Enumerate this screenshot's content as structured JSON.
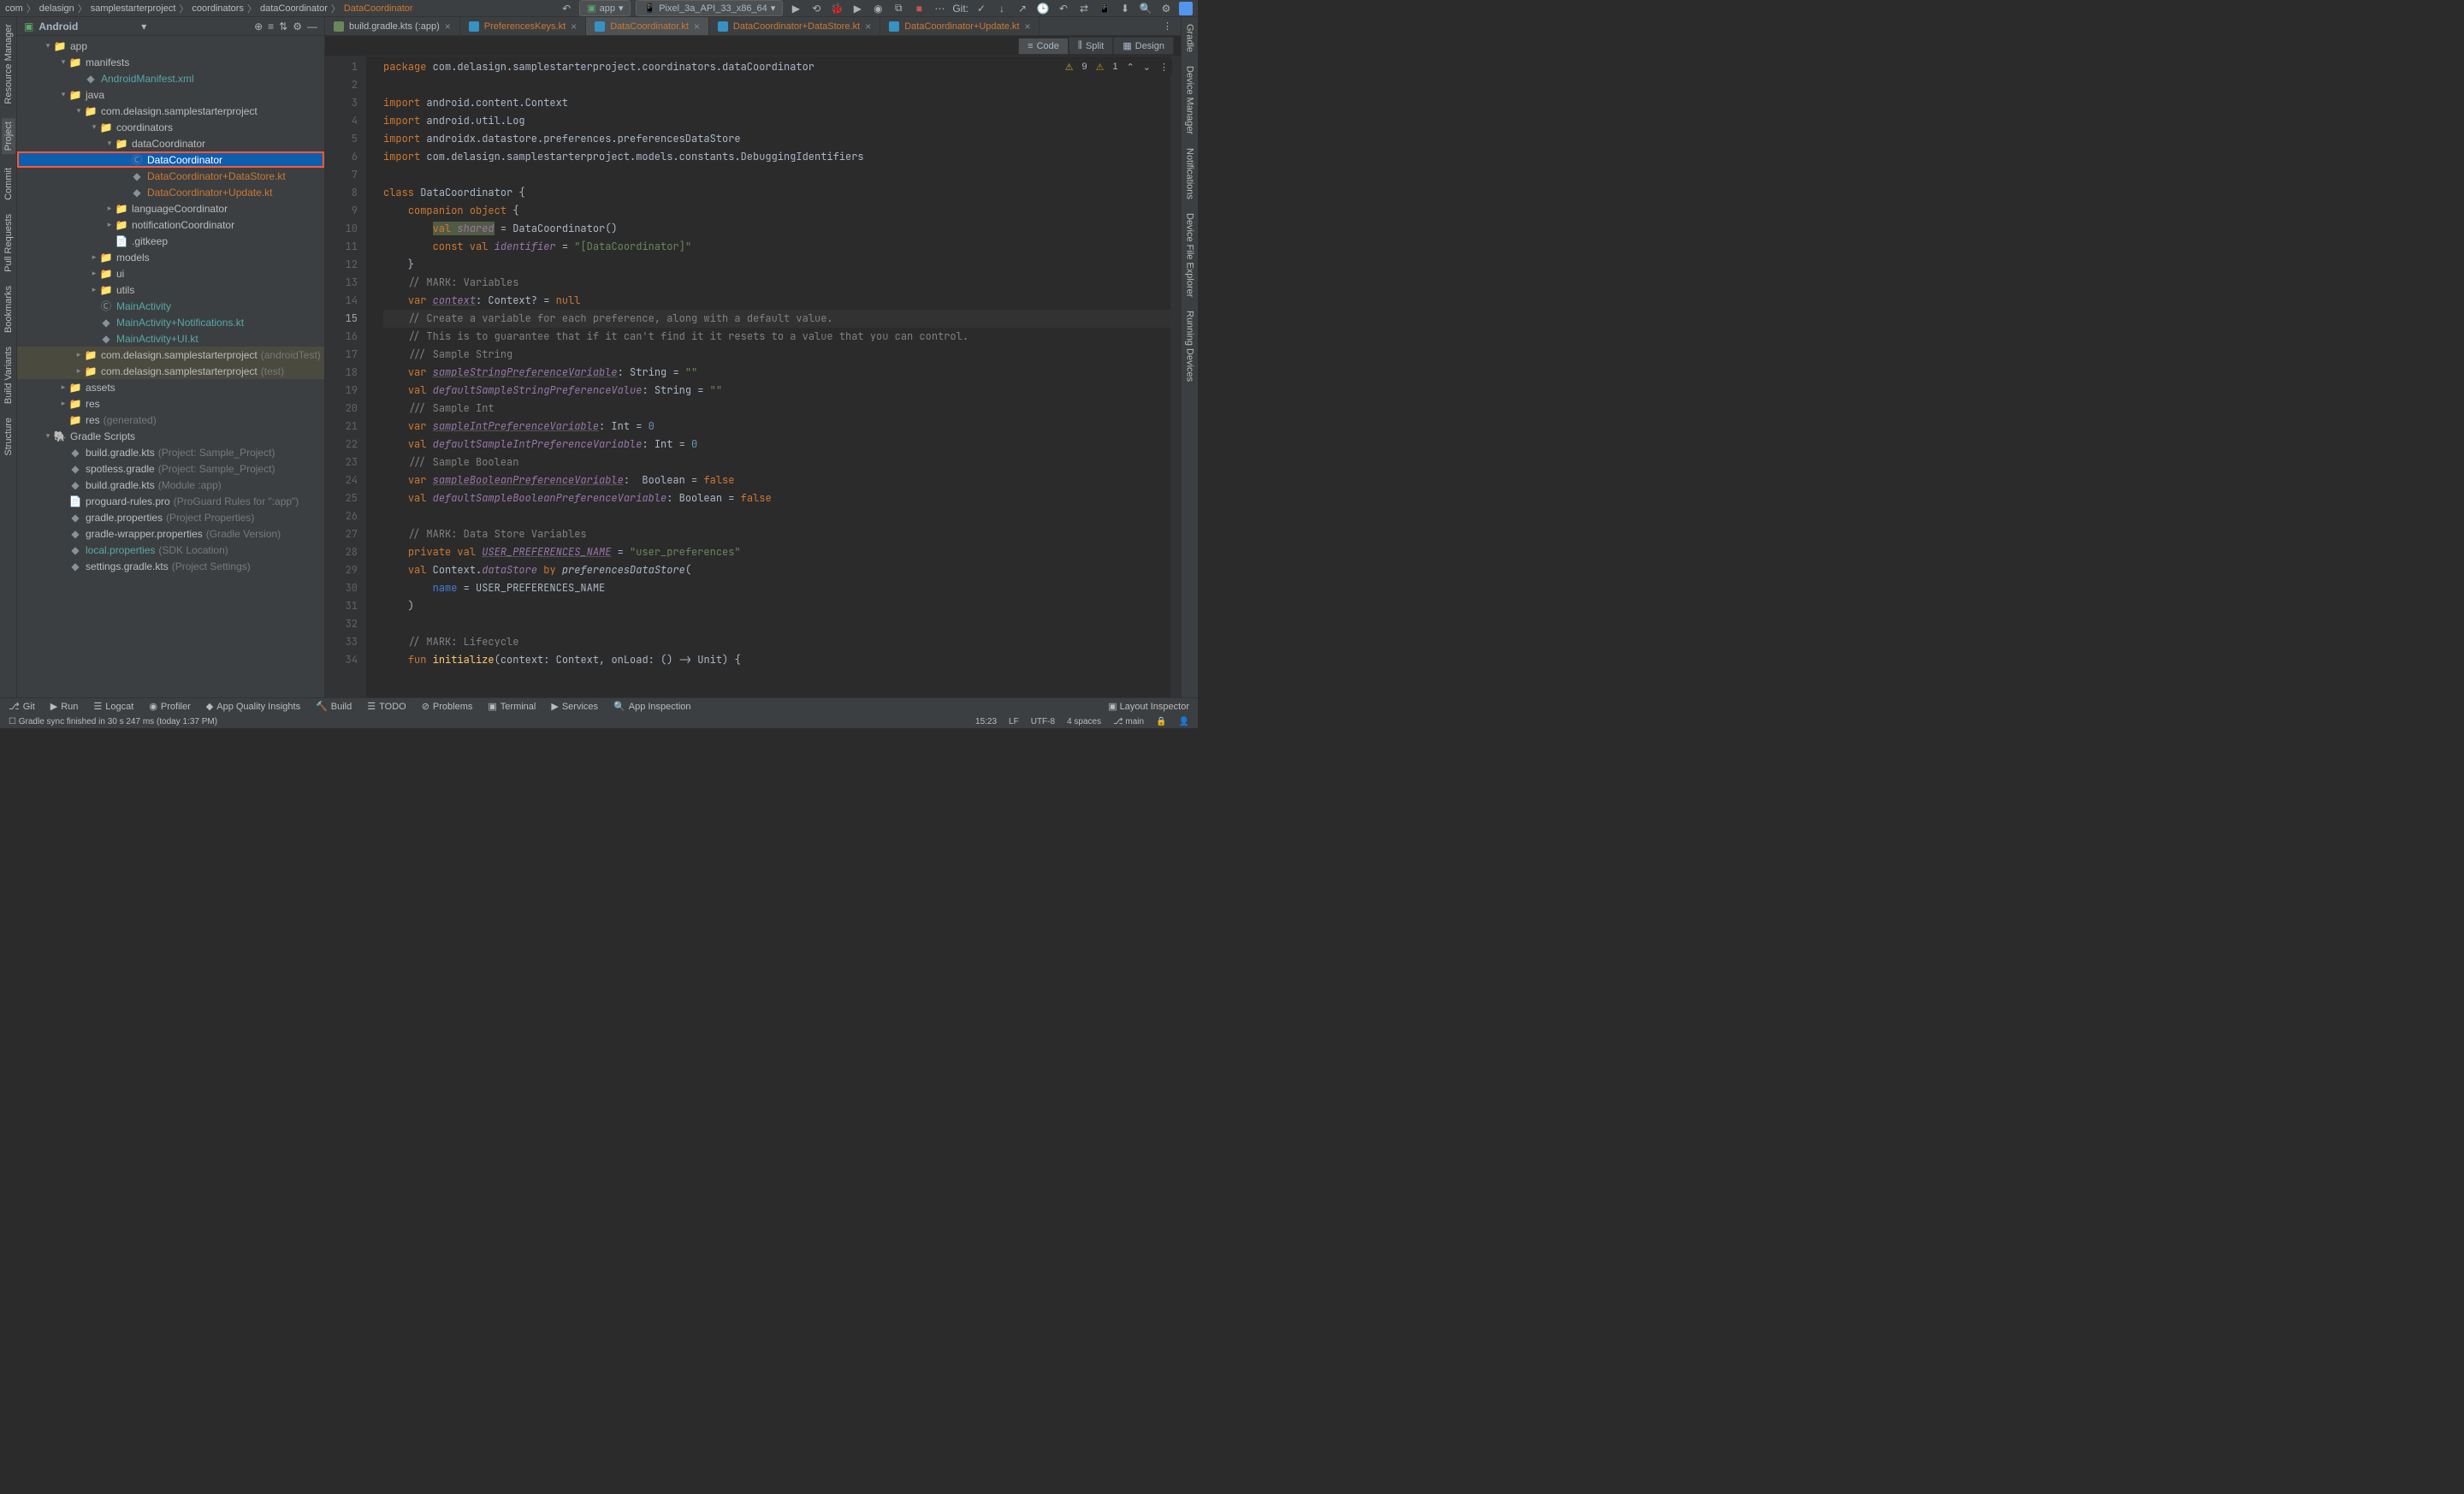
{
  "breadcrumbs": [
    "com",
    "delasign",
    "samplestarterproject",
    "coordinators",
    "dataCoordinator",
    "DataCoordinator"
  ],
  "toolbar": {
    "run_config": "app",
    "device": "Pixel_3a_API_33_x86_64",
    "git_label": "Git:"
  },
  "project_header": {
    "title": "Android"
  },
  "tree": [
    {
      "depth": 0,
      "arrow": "v",
      "icon": "module",
      "label": "app",
      "cls": ""
    },
    {
      "depth": 1,
      "arrow": "v",
      "icon": "folder",
      "label": "manifests",
      "cls": ""
    },
    {
      "depth": 2,
      "arrow": "",
      "icon": "xml",
      "label": "AndroidManifest.xml",
      "cls": "aqua"
    },
    {
      "depth": 1,
      "arrow": "v",
      "icon": "folder",
      "label": "java",
      "cls": ""
    },
    {
      "depth": 2,
      "arrow": "v",
      "icon": "pkg",
      "label": "com.delasign.samplestarterproject",
      "cls": ""
    },
    {
      "depth": 3,
      "arrow": "v",
      "icon": "pkg",
      "label": "coordinators",
      "cls": ""
    },
    {
      "depth": 4,
      "arrow": "v",
      "icon": "pkg",
      "label": "dataCoordinator",
      "cls": ""
    },
    {
      "depth": 5,
      "arrow": "",
      "icon": "class",
      "label": "DataCoordinator",
      "cls": "",
      "sel": true,
      "hl": true
    },
    {
      "depth": 5,
      "arrow": "",
      "icon": "kt",
      "label": "DataCoordinator+DataStore.kt",
      "cls": "orange"
    },
    {
      "depth": 5,
      "arrow": "",
      "icon": "kt",
      "label": "DataCoordinator+Update.kt",
      "cls": "orange"
    },
    {
      "depth": 4,
      "arrow": ">",
      "icon": "pkg",
      "label": "languageCoordinator",
      "cls": ""
    },
    {
      "depth": 4,
      "arrow": ">",
      "icon": "pkg",
      "label": "notificationCoordinator",
      "cls": ""
    },
    {
      "depth": 4,
      "arrow": "",
      "icon": "file",
      "label": ".gitkeep",
      "cls": ""
    },
    {
      "depth": 3,
      "arrow": ">",
      "icon": "pkg",
      "label": "models",
      "cls": ""
    },
    {
      "depth": 3,
      "arrow": ">",
      "icon": "pkg",
      "label": "ui",
      "cls": ""
    },
    {
      "depth": 3,
      "arrow": ">",
      "icon": "pkg",
      "label": "utils",
      "cls": ""
    },
    {
      "depth": 3,
      "arrow": "",
      "icon": "class",
      "label": "MainActivity",
      "cls": "aqua"
    },
    {
      "depth": 3,
      "arrow": "",
      "icon": "kt",
      "label": "MainActivity+Notifications.kt",
      "cls": "aqua"
    },
    {
      "depth": 3,
      "arrow": "",
      "icon": "kt",
      "label": "MainActivity+UI.kt",
      "cls": "aqua"
    },
    {
      "depth": 2,
      "arrow": ">",
      "icon": "pkg",
      "label": "com.delasign.samplestarterproject",
      "suffix": "(androidTest)",
      "cls": "",
      "shade": true
    },
    {
      "depth": 2,
      "arrow": ">",
      "icon": "pkg",
      "label": "com.delasign.samplestarterproject",
      "suffix": "(test)",
      "cls": "",
      "shade": true
    },
    {
      "depth": 1,
      "arrow": ">",
      "icon": "folder",
      "label": "assets",
      "cls": ""
    },
    {
      "depth": 1,
      "arrow": ">",
      "icon": "folder",
      "label": "res",
      "cls": ""
    },
    {
      "depth": 1,
      "arrow": "",
      "icon": "folder",
      "label": "res",
      "suffix": "(generated)",
      "cls": ""
    },
    {
      "depth": 0,
      "arrow": "v",
      "icon": "gradle",
      "label": "Gradle Scripts",
      "cls": ""
    },
    {
      "depth": 1,
      "arrow": "",
      "icon": "gkt",
      "label": "build.gradle.kts",
      "suffix": "(Project: Sample_Project)",
      "cls": ""
    },
    {
      "depth": 1,
      "arrow": "",
      "icon": "gkt",
      "label": "spotless.gradle",
      "suffix": "(Project: Sample_Project)",
      "cls": ""
    },
    {
      "depth": 1,
      "arrow": "",
      "icon": "gkt",
      "label": "build.gradle.kts",
      "suffix": "(Module :app)",
      "cls": ""
    },
    {
      "depth": 1,
      "arrow": "",
      "icon": "file",
      "label": "proguard-rules.pro",
      "suffix": "(ProGuard Rules for \":app\")",
      "cls": ""
    },
    {
      "depth": 1,
      "arrow": "",
      "icon": "gp",
      "label": "gradle.properties",
      "suffix": "(Project Properties)",
      "cls": ""
    },
    {
      "depth": 1,
      "arrow": "",
      "icon": "gp",
      "label": "gradle-wrapper.properties",
      "suffix": "(Gradle Version)",
      "cls": ""
    },
    {
      "depth": 1,
      "arrow": "",
      "icon": "gp",
      "label": "local.properties",
      "suffix": "(SDK Location)",
      "cls": "aqua"
    },
    {
      "depth": 1,
      "arrow": "",
      "icon": "gkt",
      "label": "settings.gradle.kts",
      "suffix": "(Project Settings)",
      "cls": ""
    }
  ],
  "tabs": [
    {
      "label": "build.gradle.kts (:app)",
      "color": "",
      "active": false
    },
    {
      "label": "PreferencesKeys.kt",
      "color": "orange",
      "active": false
    },
    {
      "label": "DataCoordinator.kt",
      "color": "orange",
      "active": true
    },
    {
      "label": "DataCoordinator+DataStore.kt",
      "color": "orange",
      "active": false
    },
    {
      "label": "DataCoordinator+Update.kt",
      "color": "orange",
      "active": false
    }
  ],
  "view_buttons": {
    "code": "Code",
    "split": "Split",
    "design": "Design"
  },
  "warnings": {
    "w1": "9",
    "w2": "1"
  },
  "code_lines": [
    {
      "n": 1,
      "html": "<span class='kw'>package</span> com.delasign.samplestarterproject.coordinators.dataCoordinator"
    },
    {
      "n": 2,
      "html": ""
    },
    {
      "n": 3,
      "html": "<span class='kw'>import</span> android.content.Context"
    },
    {
      "n": 4,
      "html": "<span class='kw'>import</span> android.util.Log"
    },
    {
      "n": 5,
      "html": "<span class='kw'>import</span> androidx.datastore.preferences.preferencesDataStore"
    },
    {
      "n": 6,
      "html": "<span class='kw'>import</span> com.delasign.samplestarterproject.models.constants.DebuggingIdentifiers"
    },
    {
      "n": 7,
      "html": ""
    },
    {
      "n": 8,
      "html": "<span class='kw'>class</span> DataCoordinator {"
    },
    {
      "n": 9,
      "html": "    <span class='kw'>companion</span> <span class='kw'>object</span> {"
    },
    {
      "n": 10,
      "html": "        <span class='hl'><span class='kw'>val</span> <span class='prop'>shared</span></span> = DataCoordinator()"
    },
    {
      "n": 11,
      "html": "        <span class='kw'>const val</span> <span class='prop'>identifier</span> = <span class='str'>\"[DataCoordinator]\"</span>"
    },
    {
      "n": 12,
      "html": "    }"
    },
    {
      "n": 13,
      "html": "    <span class='cmt'>// MARK: Variables</span>"
    },
    {
      "n": 14,
      "html": "    <span class='kw'>var</span> <span class='ud prop'>context</span>: Context? = <span class='kw'>null</span>"
    },
    {
      "n": 15,
      "html": "    <span class='cmt'>// Create a variable for each preference, along with a default value.</span>",
      "current": true
    },
    {
      "n": 16,
      "html": "    <span class='cmt'>// This is to guarantee that if it can't find it it resets to a value that you can control.</span>"
    },
    {
      "n": 17,
      "html": "    <span class='cmt'>/// Sample String</span>"
    },
    {
      "n": 18,
      "html": "    <span class='kw'>var</span> <span class='ud prop'>sampleStringPreferenceVariable</span>: String = <span class='str'>\"\"</span>"
    },
    {
      "n": 19,
      "html": "    <span class='kw'>val</span> <span class='prop'>defaultSampleStringPreferenceValue</span>: String = <span class='str'>\"\"</span>"
    },
    {
      "n": 20,
      "html": "    <span class='cmt'>/// Sample Int</span>"
    },
    {
      "n": 21,
      "html": "    <span class='kw'>var</span> <span class='ud prop'>sampleIntPreferenceVariable</span>: Int = <span style='color:#6897bb'>0</span>"
    },
    {
      "n": 22,
      "html": "    <span class='kw'>val</span> <span class='prop'>defaultSampleIntPreferenceVariable</span>: Int = <span style='color:#6897bb'>0</span>"
    },
    {
      "n": 23,
      "html": "    <span class='cmt'>/// Sample Boolean</span>"
    },
    {
      "n": 24,
      "html": "    <span class='kw'>var</span> <span class='ud prop'>sampleBooleanPreferenceVariable</span>:  Boolean = <span class='kw'>false</span>"
    },
    {
      "n": 25,
      "html": "    <span class='kw'>val</span> <span class='prop'>defaultSampleBooleanPreferenceVariable</span>: Boolean = <span class='kw'>false</span>"
    },
    {
      "n": 26,
      "html": ""
    },
    {
      "n": 27,
      "html": "    <span class='cmt'>// MARK: Data Store Variables</span>"
    },
    {
      "n": 28,
      "html": "    <span class='kw'>private val</span> <span class='prop ud'>USER_PREFERENCES_NAME</span> = <span class='str'>\"user_preferences\"</span>"
    },
    {
      "n": 29,
      "html": "    <span class='kw'>val</span> Context.<span class='prop'>dataStore</span> <span class='kw'>by</span> <span style='font-style:italic'>preferencesDataStore</span>("
    },
    {
      "n": 30,
      "html": "        <span style='color:#467cda'>name</span> = USER_PREFERENCES_NAME"
    },
    {
      "n": 31,
      "html": "    )"
    },
    {
      "n": 32,
      "html": ""
    },
    {
      "n": 33,
      "html": "    <span class='cmt'>// MARK: Lifecycle</span>"
    },
    {
      "n": 34,
      "html": "    <span class='kw'>fun</span> <span class='fn'>initialize</span>(context: Context, onLoad: () -> Unit) {"
    }
  ],
  "left_strip": [
    "Resource Manager",
    "Project",
    "Commit",
    "Pull Requests",
    "Bookmarks",
    "Build Variants",
    "Structure"
  ],
  "right_strip": [
    "Gradle",
    "Device Manager",
    "Notifications",
    "Device File Explorer",
    "Running Devices"
  ],
  "bottom_items": [
    "Git",
    "Run",
    "Logcat",
    "Profiler",
    "App Quality Insights",
    "Build",
    "TODO",
    "Problems",
    "Terminal",
    "Services",
    "App Inspection"
  ],
  "bottom_right": "Layout Inspector",
  "status": {
    "msg": "Gradle sync finished in 30 s 247 ms (today 1:37 PM)",
    "pos": "15:23",
    "le": "LF",
    "enc": "UTF-8",
    "indent": "4 spaces",
    "branch": "main"
  }
}
